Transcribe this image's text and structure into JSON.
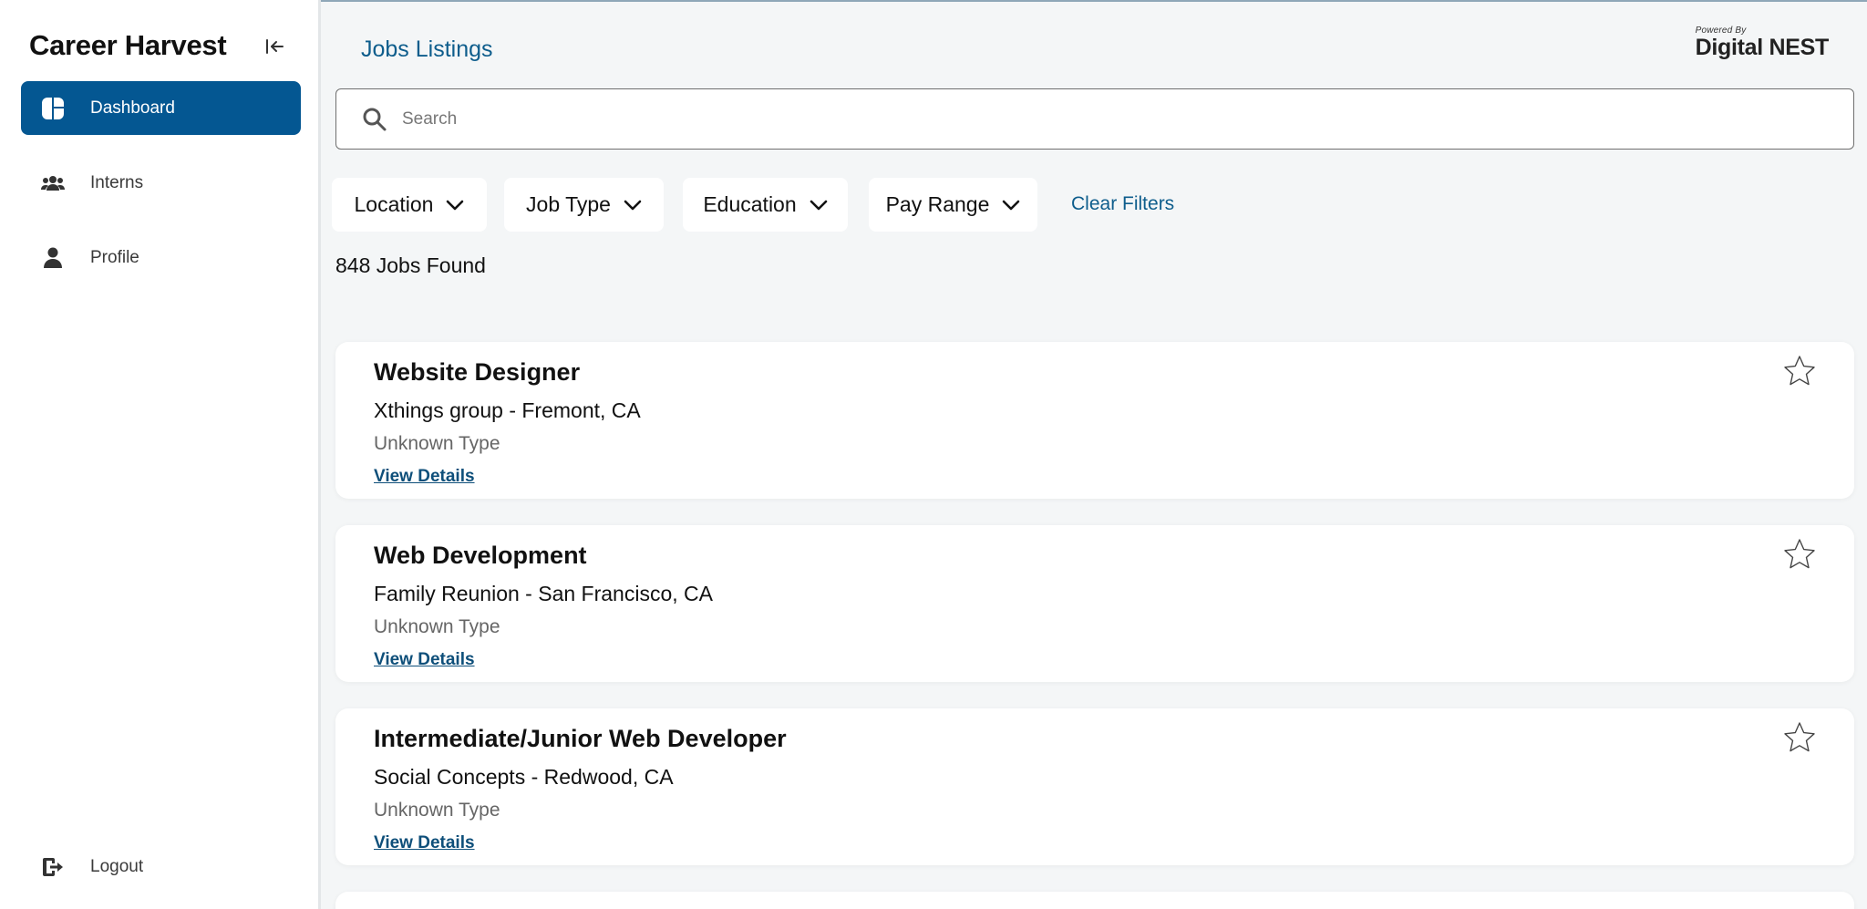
{
  "sidebar": {
    "brand": "Career Harvest",
    "items": [
      {
        "label": "Dashboard",
        "icon": "dashboard-icon",
        "active": true
      },
      {
        "label": "Interns",
        "icon": "users-icon",
        "active": false
      },
      {
        "label": "Profile",
        "icon": "user-icon",
        "active": false
      }
    ],
    "logout_label": "Logout"
  },
  "header": {
    "title": "Jobs Listings",
    "powered_by_small": "Powered By",
    "powered_by_brand": "Digital NEST"
  },
  "search": {
    "placeholder": "Search",
    "value": ""
  },
  "filters": {
    "location": "Location",
    "job_type": "Job Type",
    "education": "Education",
    "pay_range": "Pay Range",
    "clear": "Clear Filters"
  },
  "results": {
    "count_text": "848 Jobs Found"
  },
  "jobs": [
    {
      "title": "Website Designer",
      "company_location": "Xthings group - Fremont, CA",
      "type": "Unknown Type",
      "details_label": "View Details"
    },
    {
      "title": "Web Development",
      "company_location": "Family Reunion - San Francisco, CA",
      "type": "Unknown Type",
      "details_label": "View Details"
    },
    {
      "title": "Intermediate/Junior Web Developer",
      "company_location": "Social Concepts - Redwood, CA",
      "type": "Unknown Type",
      "details_label": "View Details"
    }
  ],
  "colors": {
    "accent": "#045792",
    "link": "#0e5d8c",
    "background": "#f4f6f7"
  }
}
